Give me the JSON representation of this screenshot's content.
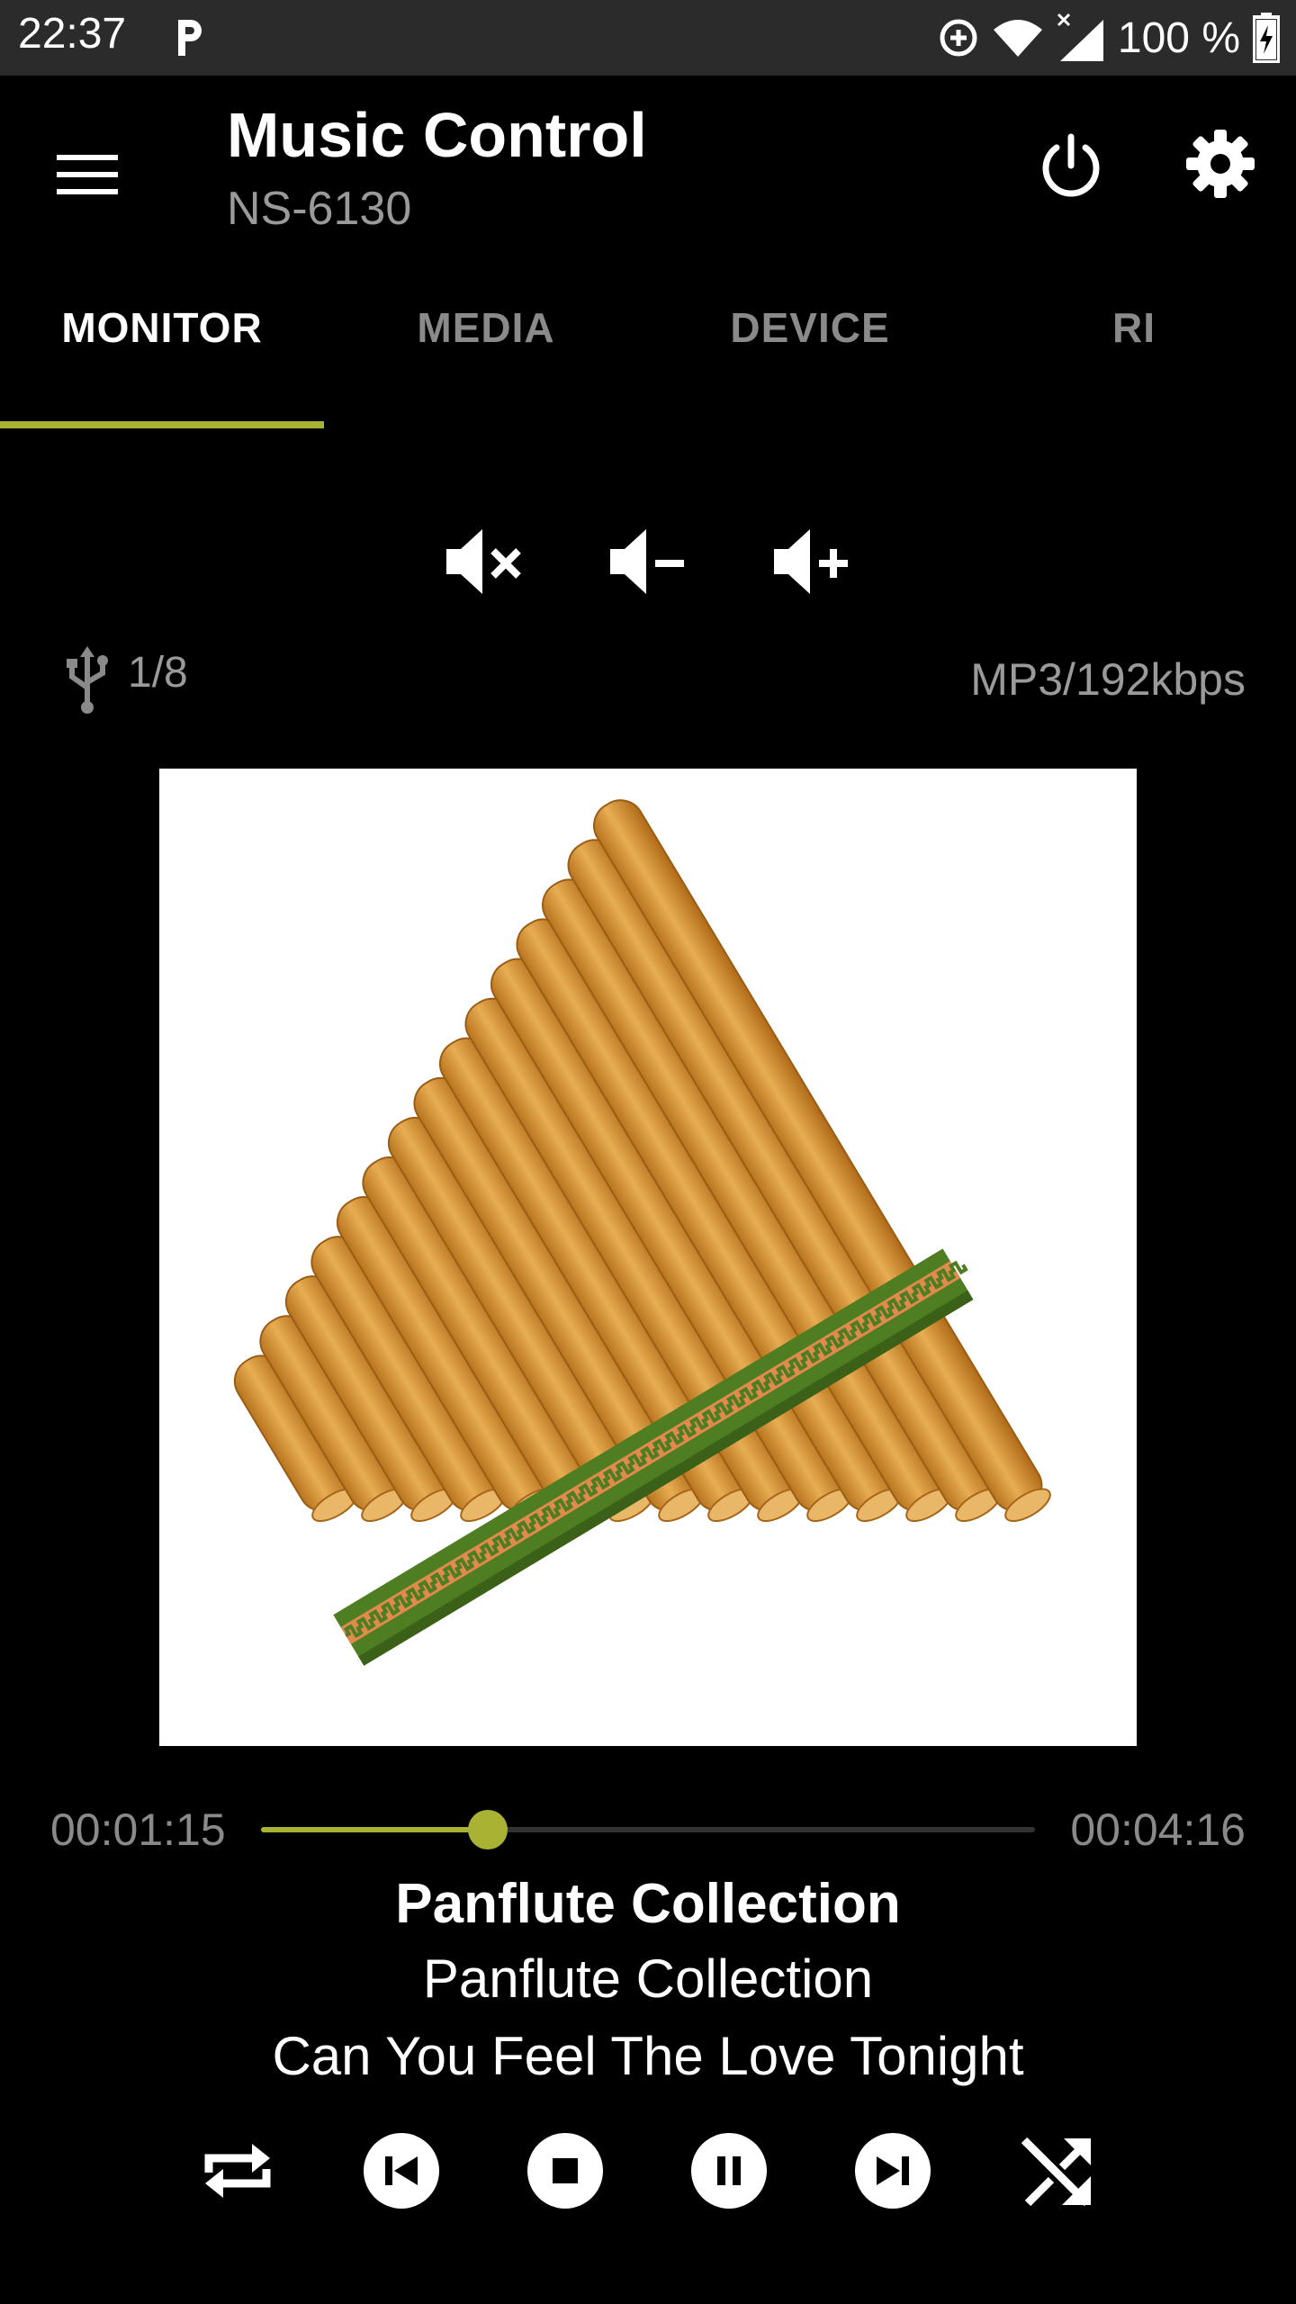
{
  "status_bar": {
    "time": "22:37",
    "battery_percent": "100 %",
    "icons": [
      "parking-app-icon",
      "data-saver-icon",
      "wifi-icon",
      "signal-icon",
      "battery-charging-icon"
    ]
  },
  "app_bar": {
    "title": "Music Control",
    "subtitle": "NS-6130",
    "icons": [
      "menu-icon",
      "power-icon",
      "settings-icon"
    ]
  },
  "tabs": [
    {
      "label": "MONITOR",
      "active": true
    },
    {
      "label": "MEDIA",
      "active": false
    },
    {
      "label": "DEVICE",
      "active": false
    },
    {
      "label": "RI",
      "active": false
    }
  ],
  "volume": {
    "icons": [
      "volume-mute-icon",
      "volume-down-icon",
      "volume-up-icon"
    ]
  },
  "source": {
    "icon": "usb-icon",
    "track_position": "1/8",
    "format": "MP3/192kbps"
  },
  "playback": {
    "elapsed": "00:01:15",
    "total": "00:04:16",
    "progress_fraction": 0.293
  },
  "track": {
    "album": "Panflute Collection",
    "artist": "Panflute Collection",
    "title": "Can You Feel The Love Tonight"
  },
  "transport": {
    "icons": [
      "repeat-icon",
      "previous-icon",
      "stop-icon",
      "pause-icon",
      "next-icon",
      "shuffle-icon"
    ]
  },
  "colors": {
    "accent": "#a9b232",
    "background": "#000000",
    "status_bar": "#2b2b2b",
    "secondary_text": "#9a9a9a"
  }
}
